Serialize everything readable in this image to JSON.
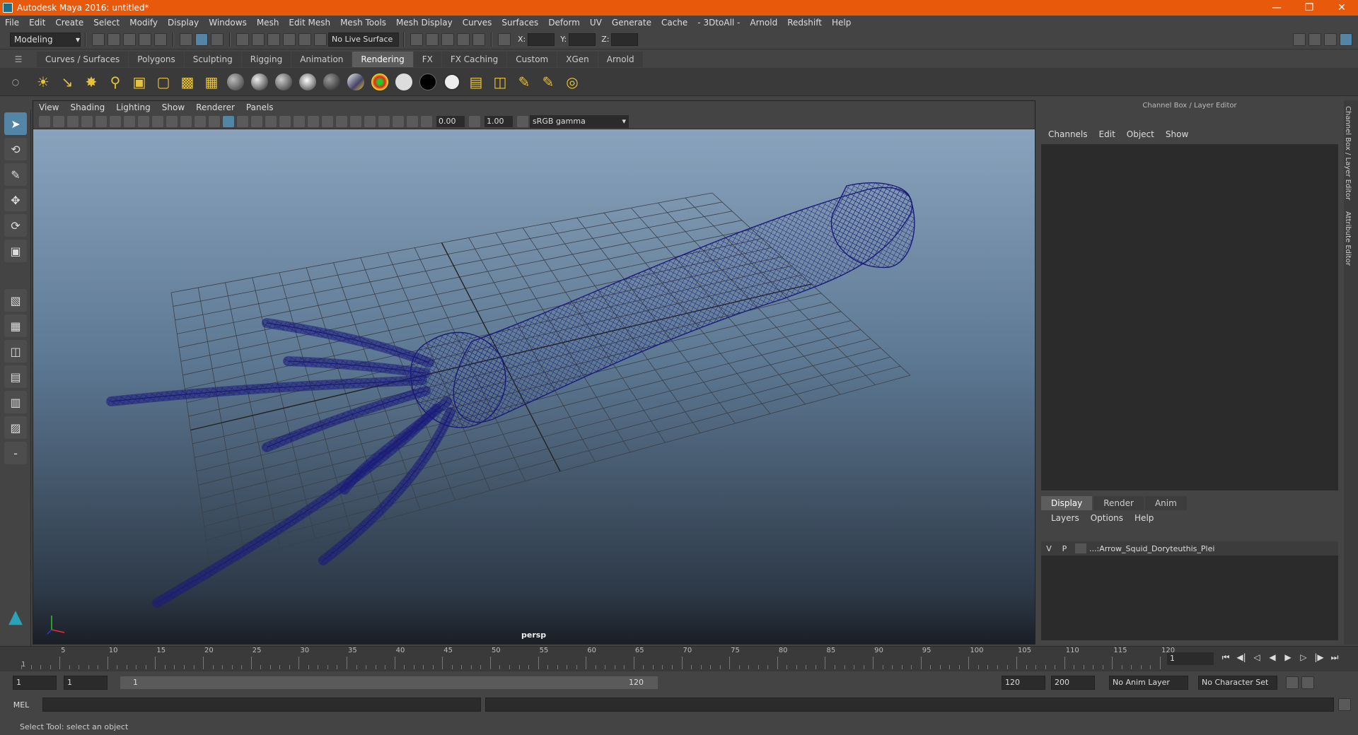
{
  "titlebar": {
    "title": "Autodesk Maya 2016: untitled*"
  },
  "menubar": {
    "items": [
      "File",
      "Edit",
      "Create",
      "Select",
      "Modify",
      "Display",
      "Windows",
      "Mesh",
      "Edit Mesh",
      "Mesh Tools",
      "Mesh Display",
      "Curves",
      "Surfaces",
      "Deform",
      "UV",
      "Generate",
      "Cache",
      "- 3DtoAll -",
      "Arnold",
      "Redshift",
      "Help"
    ]
  },
  "statusline": {
    "mode": "Modeling",
    "live_surface": "No Live Surface",
    "x_label": "X:",
    "y_label": "Y:",
    "z_label": "Z:"
  },
  "shelf": {
    "tabs": [
      "Curves / Surfaces",
      "Polygons",
      "Sculpting",
      "Rigging",
      "Animation",
      "Rendering",
      "FX",
      "FX Caching",
      "Custom",
      "XGen",
      "Arnold"
    ],
    "active_tab": "Rendering"
  },
  "viewport": {
    "menu": [
      "View",
      "Shading",
      "Lighting",
      "Show",
      "Renderer",
      "Panels"
    ],
    "exposure": "0.00",
    "gamma": "1.00",
    "colorspace": "sRGB gamma",
    "camera": "persp",
    "wire_color": "#1a1a7a"
  },
  "channelbox": {
    "title": "Channel Box / Layer Editor",
    "menu": [
      "Channels",
      "Edit",
      "Object",
      "Show"
    ]
  },
  "layereditor": {
    "tabs": [
      "Display",
      "Render",
      "Anim"
    ],
    "active_tab": "Display",
    "menu": [
      "Layers",
      "Options",
      "Help"
    ],
    "layer": {
      "v": "V",
      "p": "P",
      "name": "...:Arrow_Squid_Doryteuthis_Plei"
    }
  },
  "sidetabs": [
    "Channel Box / Layer Editor",
    "Attribute Editor"
  ],
  "timeline": {
    "ticks": [
      "5",
      "10",
      "15",
      "20",
      "25",
      "30",
      "35",
      "40",
      "45",
      "50",
      "55",
      "60",
      "65",
      "70",
      "75",
      "80",
      "85",
      "90",
      "95",
      "100",
      "105",
      "110",
      "115",
      "120"
    ],
    "first": "1",
    "current_frame": "1"
  },
  "range": {
    "start": "1",
    "anim_start": "1",
    "slider_start": "1",
    "slider_end": "120",
    "end": "120",
    "anim_end": "200",
    "anim_layer": "No Anim Layer",
    "char_set": "No Character Set"
  },
  "cmdline": {
    "label": "MEL"
  },
  "helpline": {
    "text": "Select Tool: select an object"
  }
}
